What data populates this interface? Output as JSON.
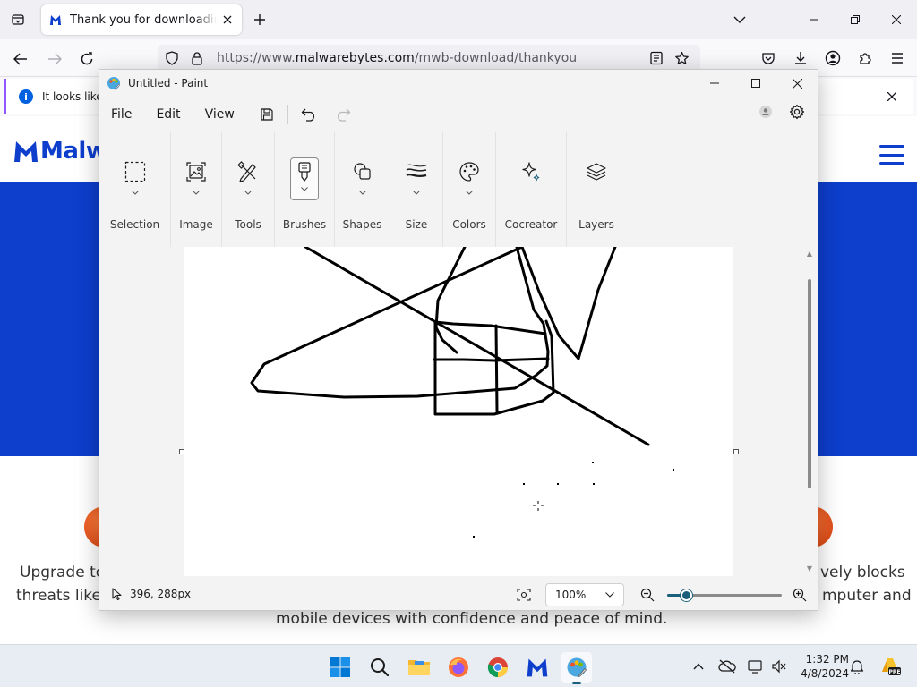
{
  "browser": {
    "tab_title": "Thank you for downloading Malwarebytes",
    "url_prefix": "https://www.",
    "url_domain": "malwarebytes.com",
    "url_path": "/mwb-download/thankyou",
    "notification_text": "It looks like y"
  },
  "site": {
    "logo_text": "Malwar",
    "line1_left": "Upgrade to",
    "line1_right": "vely blocks",
    "line2_left": "threats like",
    "line2_right": "mputer and",
    "line3": "mobile devices with confidence and peace of mind."
  },
  "paint": {
    "title": "Untitled - Paint",
    "menu": [
      "File",
      "Edit",
      "View"
    ],
    "ribbon": [
      {
        "label": "Selection",
        "icon": "selection-icon"
      },
      {
        "label": "Image",
        "icon": "image-icon"
      },
      {
        "label": "Tools",
        "icon": "tools-icon"
      },
      {
        "label": "Brushes",
        "icon": "brush-icon"
      },
      {
        "label": "Shapes",
        "icon": "shapes-icon"
      },
      {
        "label": "Size",
        "icon": "size-icon"
      },
      {
        "label": "Colors",
        "icon": "palette-icon"
      },
      {
        "label": "Cocreator",
        "icon": "sparkle-icon"
      },
      {
        "label": "Layers",
        "icon": "layers-icon"
      }
    ],
    "cursor_position": "396, 288px",
    "zoom_level": "100%",
    "zoom_slider_fraction": 0.17
  },
  "taskbar": {
    "time": "1:32 PM",
    "date": "4/8/2024"
  },
  "colors": {
    "brand_blue": "#0d3ecc",
    "accent": "#1a5f7a"
  }
}
